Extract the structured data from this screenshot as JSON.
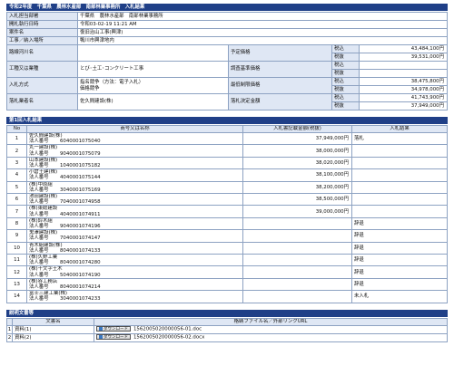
{
  "header": {
    "title": "令和2年度　千葉県　農林水産部　南部林業事務所　入札結果"
  },
  "info": {
    "office_label": "入札担当部署",
    "office_value": "千葉県　農林水産部　南部林業事務所",
    "datetime_label": "開札執行日時",
    "datetime_value": "令和03-02-19 11:21 AM",
    "case_label": "案件名",
    "case_value": "復旧治山工事(興津)",
    "place_label": "工事／納入場所",
    "place_value": "鴨川市興津地内",
    "published_label": "路線河川名",
    "type_label": "工種又は業種",
    "type_value": "とび･土工･コンクリート工事",
    "method_label": "入札方式",
    "method_value_1": "指名競争（方法：電子入札）",
    "method_value_2": "価格競争",
    "winner_label": "落札業者名",
    "winner_value": "佐久間建設(株)",
    "prices": [
      {
        "label": "予定価格",
        "rows": [
          {
            "tax": "税込",
            "value": "43,484,100円"
          },
          {
            "tax": "税抜",
            "value": "39,531,000円"
          }
        ]
      },
      {
        "label": "調査基準価格",
        "rows": [
          {
            "tax": "税込",
            "value": ""
          },
          {
            "tax": "税抜",
            "value": ""
          }
        ]
      },
      {
        "label": "最低制限価格",
        "rows": [
          {
            "tax": "税込",
            "value": "38,475,800円"
          },
          {
            "tax": "税抜",
            "value": "34,978,000円"
          }
        ]
      },
      {
        "label": "落札決定金額",
        "rows": [
          {
            "tax": "税込",
            "value": "41,743,900円"
          },
          {
            "tax": "税抜",
            "value": "37,949,000円"
          }
        ]
      }
    ]
  },
  "results": {
    "title": "第1回入札結果",
    "columns": [
      "No",
      "商号又は名称",
      "入札書記載金額(税抜)",
      "入札結果"
    ],
    "corp_prefix": "法人番号",
    "rows": [
      {
        "no": "1",
        "name": "佐久間建設(株)",
        "corp": "6040001075040",
        "amount": "37,949,000円",
        "result": "落札"
      },
      {
        "no": "2",
        "name": "丸一建設(株)",
        "corp": "9040001075079",
        "amount": "38,000,000円",
        "result": ""
      },
      {
        "no": "3",
        "name": "山本建設(株)",
        "corp": "1040001075182",
        "amount": "38,020,000円",
        "result": ""
      },
      {
        "no": "4",
        "name": "小倉土建(株)",
        "corp": "4040001075144",
        "amount": "38,100,000円",
        "result": ""
      },
      {
        "no": "5",
        "name": "(株)中原組",
        "corp": "3040001075169",
        "amount": "38,200,000円",
        "result": ""
      },
      {
        "no": "6",
        "name": "池田建設(株)",
        "corp": "7040001074958",
        "amount": "38,500,000円",
        "result": ""
      },
      {
        "no": "7",
        "name": "(株)東総建設",
        "corp": "4040001074911",
        "amount": "39,000,000円",
        "result": ""
      },
      {
        "no": "8",
        "name": "(株)鈴木組",
        "corp": "9040001074196",
        "amount": "",
        "result": "辞退"
      },
      {
        "no": "9",
        "name": "鬼澤建設(株)",
        "corp": "7040001074147",
        "amount": "",
        "result": "辞退"
      },
      {
        "no": "10",
        "name": "青木組建設(株)",
        "corp": "8040001074133",
        "amount": "",
        "result": "辞退"
      },
      {
        "no": "11",
        "name": "(株)久野工業",
        "corp": "8040001074280",
        "amount": "",
        "result": "辞退"
      },
      {
        "no": "12",
        "name": "(株)十文字土木",
        "corp": "5040001074190",
        "amount": "",
        "result": "辞退"
      },
      {
        "no": "13",
        "name": "(株)谷工務店",
        "corp": "8040001074214",
        "amount": "",
        "result": "辞退"
      },
      {
        "no": "14",
        "name": "富士三建工業(株)",
        "corp": "3040001074233",
        "amount": "",
        "result": "未入札"
      }
    ]
  },
  "docs": {
    "title": "説明文書等",
    "col_doc": "文書名",
    "col_file": "格納ファイル名／外部リンクURL",
    "button_label": "ダウンロード",
    "rows": [
      {
        "no": "1",
        "name": "資料(1)",
        "file": "1562005020000056-01.doc"
      },
      {
        "no": "2",
        "name": "資料(2)",
        "file": "1562005020000056-02.docx"
      }
    ]
  }
}
